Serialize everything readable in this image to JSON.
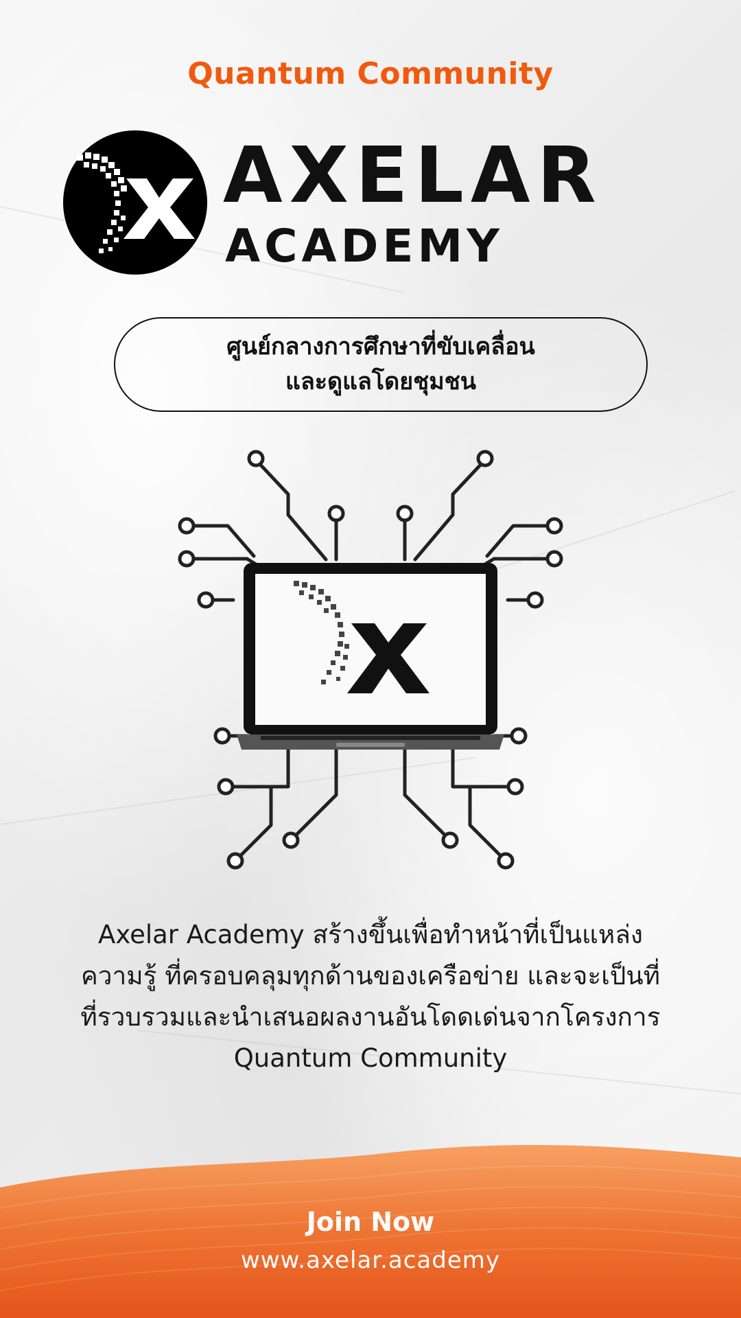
{
  "header": {
    "title": "Quantum Community"
  },
  "brand": {
    "main": "AXELAR",
    "sub": "ACADEMY",
    "logo_icon": "x-logo-icon"
  },
  "tagline": {
    "line1": "ศูนย์กลางการศึกษาที่ขับเคลื่อน",
    "line2": "และดูแลโดยชุมชน"
  },
  "illustration": {
    "icon": "laptop-circuit-icon"
  },
  "description": {
    "line1": "Axelar Academy สร้างขึ้นเพื่อทำหน้าที่เป็นแหล่ง",
    "line2": "ความรู้ ที่ครอบคลุมทุกด้านของเครือข่าย และจะเป็นที่",
    "line3": "ที่รวบรวมและนำเสนอผลงานอันโดดเด่นจากโครงการ",
    "line4": "Quantum Community"
  },
  "footer": {
    "cta": "Join Now",
    "url": "www.axelar.academy"
  },
  "colors": {
    "accent": "#f05a0e",
    "ink": "#111111",
    "wave_top": "#f7a062",
    "wave_bottom": "#e5541a"
  }
}
